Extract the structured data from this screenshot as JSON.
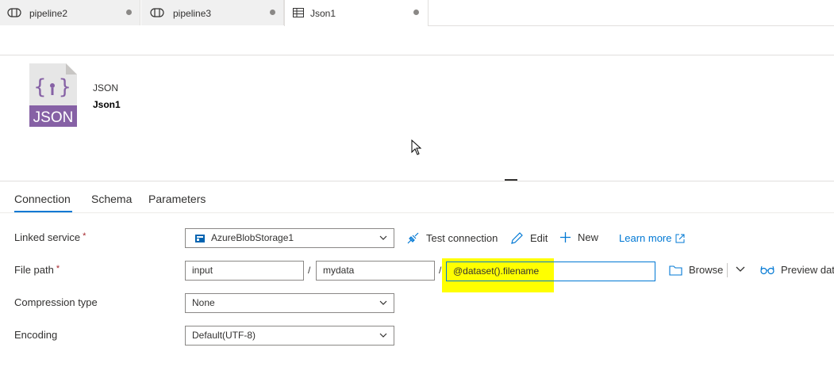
{
  "tabs": [
    {
      "label": "pipeline2",
      "icon": "pipeline-icon",
      "active": false
    },
    {
      "label": "pipeline3",
      "icon": "pipeline-icon",
      "active": false
    },
    {
      "label": "Json1",
      "icon": "table-icon",
      "active": true
    }
  ],
  "dataset": {
    "icon_text": "JSON",
    "type": "JSON",
    "name": "Json1"
  },
  "subtabs": [
    "Connection",
    "Schema",
    "Parameters"
  ],
  "form": {
    "linked_service": {
      "label": "Linked service",
      "required": "*",
      "value": "AzureBlobStorage1",
      "actions": {
        "test_connection": "Test connection",
        "edit": "Edit",
        "new": "New",
        "learn_more": "Learn more"
      }
    },
    "file_path": {
      "label": "File path",
      "required": "*",
      "container": "input",
      "directory": "mydata",
      "file": "@dataset().filename",
      "separator": "/",
      "browse": "Browse",
      "preview": "Preview data"
    },
    "compression_type": {
      "label": "Compression type",
      "value": "None"
    },
    "encoding": {
      "label": "Encoding",
      "value": "Default(UTF-8)"
    }
  },
  "colors": {
    "accent": "#0078d4",
    "json_icon": "#8661a5",
    "highlight": "#ffff00"
  }
}
